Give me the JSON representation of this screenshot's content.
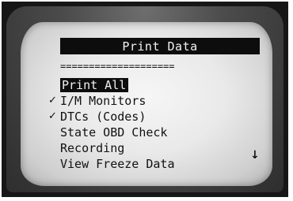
{
  "header": {
    "title": "Print Data"
  },
  "divider_text": "====================",
  "menu": {
    "items": [
      {
        "label": "Print All",
        "selected": true,
        "checked": false
      },
      {
        "label": "I/M Monitors",
        "selected": false,
        "checked": true
      },
      {
        "label": "DTCs (Codes)",
        "selected": false,
        "checked": true
      },
      {
        "label": "State OBD Check",
        "selected": false,
        "checked": false
      },
      {
        "label": "Recording",
        "selected": false,
        "checked": false
      },
      {
        "label": "View Freeze Data",
        "selected": false,
        "checked": false
      }
    ]
  },
  "icons": {
    "check": "check-icon",
    "scroll": "down-arrow-icon"
  },
  "colors": {
    "screen_bg": "#ececec",
    "ink": "#111111",
    "highlight": "#0d0d0d"
  }
}
